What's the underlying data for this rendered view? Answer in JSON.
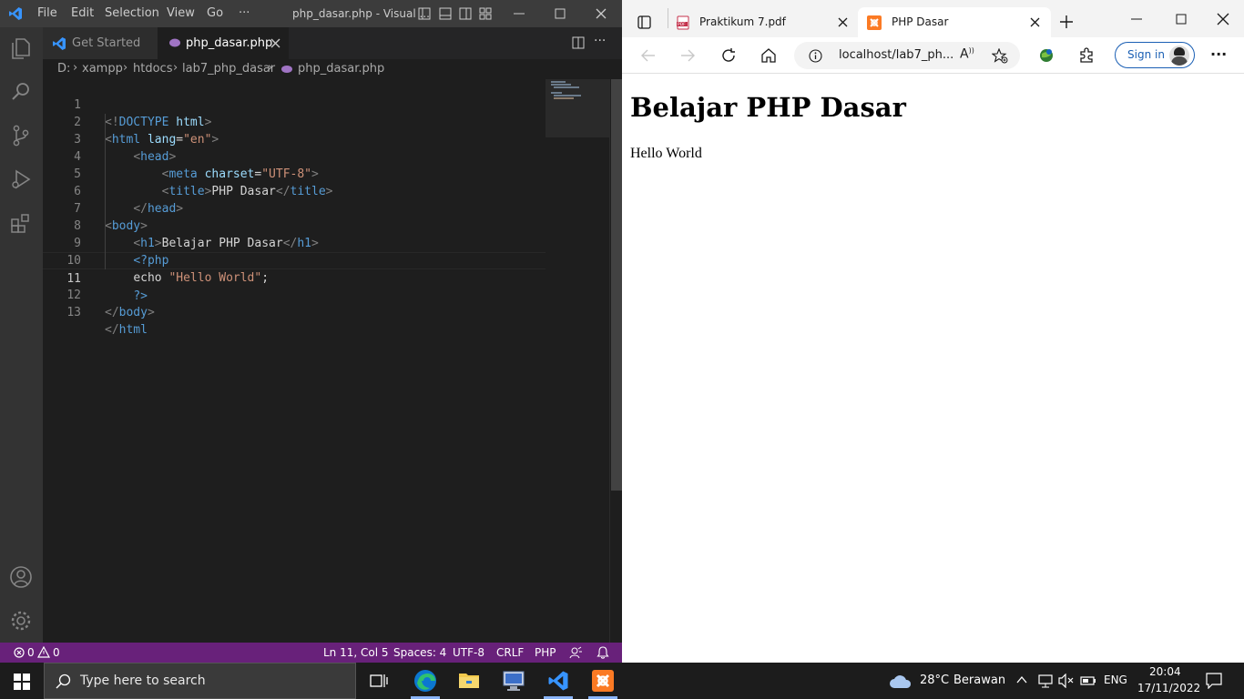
{
  "vscode": {
    "title": "php_dasar.php - Visual ...",
    "menu": [
      "File",
      "Edit",
      "Selection",
      "View",
      "Go",
      "···"
    ],
    "tabs": [
      {
        "label": "Get Started"
      },
      {
        "label": "php_dasar.php"
      }
    ],
    "breadcrumb": [
      "D:",
      "xampp",
      "htdocs",
      "lab7_php_dasar",
      "php_dasar.php"
    ],
    "line_numbers": [
      "1",
      "2",
      "3",
      "4",
      "5",
      "6",
      "7",
      "8",
      "9",
      "10",
      "11",
      "12",
      "13"
    ],
    "code": {
      "l1": {
        "a": "<!",
        "b": "DOCTYPE",
        "c": "html",
        "d": ">"
      },
      "l2": {
        "a": "<",
        "b": "html",
        "c": "lang",
        "d": "=",
        "e": "\"en\"",
        "f": ">"
      },
      "l3": {
        "a": "<",
        "b": "head",
        "c": ">"
      },
      "l4": {
        "a": "<",
        "b": "meta",
        "c": "charset",
        "d": "=",
        "e": "\"UTF-8\"",
        "f": ">"
      },
      "l5": {
        "a": "<",
        "b": "title",
        "c": ">",
        "d": "PHP Dasar",
        "e": "</",
        "f": "title",
        "g": ">"
      },
      "l6": {
        "a": "</",
        "b": "head",
        "c": ">"
      },
      "l7": {
        "a": "<",
        "b": "body",
        "c": ">"
      },
      "l8": {
        "a": "<",
        "b": "h1",
        "c": ">",
        "d": "Belajar PHP Dasar",
        "e": "</",
        "f": "h1",
        "g": ">"
      },
      "l9": {
        "a": "<?php"
      },
      "l10": {
        "a": "echo ",
        "b": "\"Hello World\"",
        "c": ";"
      },
      "l11": {
        "a": "?>"
      },
      "l12": {
        "a": "</",
        "b": "body",
        "c": ">"
      },
      "l13": {
        "a": "</",
        "b": "html"
      }
    },
    "status": {
      "problems_errors": "0",
      "problems_warnings": "0",
      "position": "Ln 11, Col 5",
      "spaces": "Spaces: 4",
      "encoding": "UTF-8",
      "eol": "CRLF",
      "language": "PHP"
    }
  },
  "browser": {
    "tabs": [
      {
        "label": "Praktikum 7.pdf"
      },
      {
        "label": "PHP Dasar"
      }
    ],
    "address": "localhost/lab7_ph...",
    "sign_in": "Sign in",
    "page": {
      "heading": "Belajar PHP Dasar",
      "text": "Hello World"
    }
  },
  "taskbar": {
    "search_placeholder": "Type here to search",
    "weather_temp": "28°C",
    "weather_desc": "Berawan",
    "language": "ENG",
    "time": "20:04",
    "date": "17/11/2022"
  },
  "colors": {
    "statusbar": "#68217a",
    "vscode_accent": "#3794ff",
    "xampp_orange": "#fb7a24"
  }
}
